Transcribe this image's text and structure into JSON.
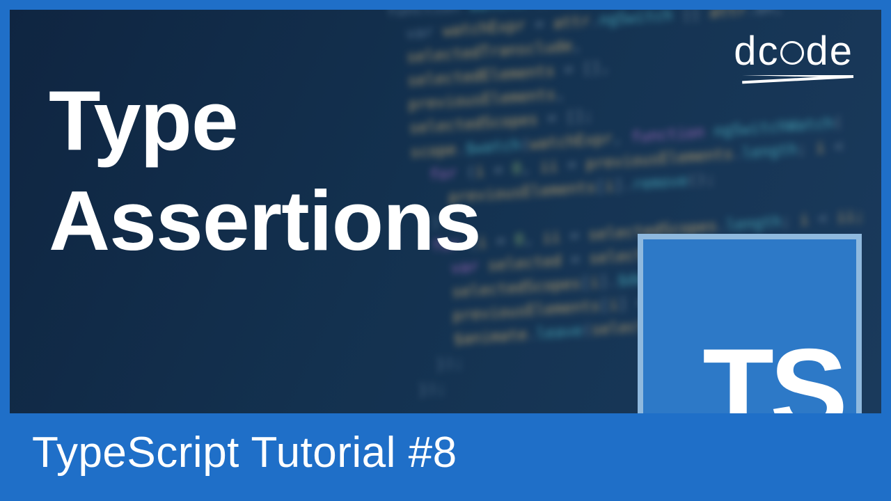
{
  "title_line1": "Type",
  "title_line2": "Assertions",
  "footer": "TypeScript Tutorial #8",
  "logo_text_left": "dc",
  "logo_text_right": "de",
  "ts_label": "TS",
  "code_lines": [
    {
      "segments": [
        {
          "c": "pl",
          "t": "function "
        },
        {
          "c": "fn",
          "t": "watcher"
        },
        {
          "c": "pn",
          "t": "(scope, "
        },
        {
          "c": "id",
          "t": "element"
        },
        {
          "c": "pn",
          "t": ", "
        },
        {
          "c": "id",
          "t": "attr"
        },
        {
          "c": "pn",
          "t": ", "
        },
        {
          "c": "fn",
          "t": "ngSwitch"
        },
        {
          "c": "pn",
          "t": ")"
        }
      ]
    },
    {
      "segments": [
        {
          "c": "pl",
          "t": "  var "
        },
        {
          "c": "id",
          "t": "watchExpr"
        },
        {
          "c": "op",
          "t": " = "
        },
        {
          "c": "id",
          "t": "attr"
        },
        {
          "c": "pn",
          "t": "."
        },
        {
          "c": "fn",
          "t": "ngSwitch"
        },
        {
          "c": "op",
          "t": " || "
        },
        {
          "c": "id",
          "t": "attr"
        },
        {
          "c": "pn",
          "t": ".on,"
        }
      ]
    },
    {
      "segments": [
        {
          "c": "pl",
          "t": "  "
        },
        {
          "c": "id",
          "t": "selectedTransclude"
        },
        {
          "c": "pn",
          "t": ","
        }
      ]
    },
    {
      "segments": [
        {
          "c": "pl",
          "t": "  "
        },
        {
          "c": "id",
          "t": "selectedElements"
        },
        {
          "c": "op",
          "t": " = "
        },
        {
          "c": "pn",
          "t": "[],"
        }
      ]
    },
    {
      "segments": [
        {
          "c": "pl",
          "t": "  "
        },
        {
          "c": "id",
          "t": "previousElements"
        },
        {
          "c": "pn",
          "t": ","
        }
      ]
    },
    {
      "segments": [
        {
          "c": "pl",
          "t": "  "
        },
        {
          "c": "id",
          "t": "selectedScopes"
        },
        {
          "c": "op",
          "t": " = "
        },
        {
          "c": "pn",
          "t": "[];"
        }
      ]
    },
    {
      "segments": [
        {
          "c": "pl",
          "t": ""
        }
      ]
    },
    {
      "segments": [
        {
          "c": "pl",
          "t": "  "
        },
        {
          "c": "id",
          "t": "scope"
        },
        {
          "c": "pn",
          "t": "."
        },
        {
          "c": "fn",
          "t": "$watch"
        },
        {
          "c": "pn",
          "t": "("
        },
        {
          "c": "id",
          "t": "watchExpr"
        },
        {
          "c": "pn",
          "t": ", "
        },
        {
          "c": "kw",
          "t": "function"
        },
        {
          "c": "pn",
          "t": " "
        },
        {
          "c": "fn",
          "t": "ngSwitchWatch"
        },
        {
          "c": "pn",
          "t": "("
        }
      ]
    },
    {
      "segments": [
        {
          "c": "pl",
          "t": "    "
        },
        {
          "c": "kw",
          "t": "for"
        },
        {
          "c": "pn",
          "t": " ("
        },
        {
          "c": "id",
          "t": "i"
        },
        {
          "c": "op",
          "t": " = "
        },
        {
          "c": "st",
          "t": "0"
        },
        {
          "c": "pn",
          "t": ", "
        },
        {
          "c": "id",
          "t": "ii"
        },
        {
          "c": "op",
          "t": " = "
        },
        {
          "c": "id",
          "t": "previousElements"
        },
        {
          "c": "pn",
          "t": "."
        },
        {
          "c": "fn",
          "t": "length"
        },
        {
          "c": "pn",
          "t": "; "
        },
        {
          "c": "id",
          "t": "i"
        },
        {
          "c": "op",
          "t": " < "
        }
      ]
    },
    {
      "segments": [
        {
          "c": "pl",
          "t": "      "
        },
        {
          "c": "id",
          "t": "previousElements"
        },
        {
          "c": "pn",
          "t": "["
        },
        {
          "c": "id",
          "t": "i"
        },
        {
          "c": "pn",
          "t": "]."
        },
        {
          "c": "fn",
          "t": "remove"
        },
        {
          "c": "pn",
          "t": "();"
        }
      ]
    },
    {
      "segments": [
        {
          "c": "pl",
          "t": "    }"
        }
      ]
    },
    {
      "segments": [
        {
          "c": "pl",
          "t": ""
        }
      ]
    },
    {
      "segments": [
        {
          "c": "pl",
          "t": "    "
        },
        {
          "c": "kw",
          "t": "for"
        },
        {
          "c": "pn",
          "t": " ("
        },
        {
          "c": "id",
          "t": "i"
        },
        {
          "c": "op",
          "t": " = "
        },
        {
          "c": "st",
          "t": "0"
        },
        {
          "c": "pn",
          "t": ", "
        },
        {
          "c": "id",
          "t": "ii"
        },
        {
          "c": "op",
          "t": " = "
        },
        {
          "c": "id",
          "t": "selectedScopes"
        },
        {
          "c": "pn",
          "t": "."
        },
        {
          "c": "fn",
          "t": "length"
        },
        {
          "c": "pn",
          "t": "; "
        },
        {
          "c": "id",
          "t": "i"
        },
        {
          "c": "op",
          "t": " < "
        },
        {
          "c": "id",
          "t": "ii;"
        }
      ]
    },
    {
      "segments": [
        {
          "c": "pl",
          "t": "      "
        },
        {
          "c": "kw",
          "t": "var"
        },
        {
          "c": "pn",
          "t": " "
        },
        {
          "c": "id",
          "t": "selected"
        },
        {
          "c": "op",
          "t": " = "
        },
        {
          "c": "id",
          "t": "selectedElements"
        },
        {
          "c": "pn",
          "t": "["
        },
        {
          "c": "id",
          "t": "i"
        },
        {
          "c": "pn",
          "t": "];"
        }
      ]
    },
    {
      "segments": [
        {
          "c": "pl",
          "t": "      "
        },
        {
          "c": "id",
          "t": "selectedScopes"
        },
        {
          "c": "pn",
          "t": "["
        },
        {
          "c": "id",
          "t": "i"
        },
        {
          "c": "pn",
          "t": "]."
        },
        {
          "c": "fn",
          "t": "$destroy"
        },
        {
          "c": "pn",
          "t": "();"
        }
      ]
    },
    {
      "segments": [
        {
          "c": "pl",
          "t": "      "
        },
        {
          "c": "id",
          "t": "previousElements"
        },
        {
          "c": "pn",
          "t": "["
        },
        {
          "c": "id",
          "t": "i"
        },
        {
          "c": "pn",
          "t": "] = "
        },
        {
          "c": "id",
          "t": "selected"
        },
        {
          "c": "pn",
          "t": ";"
        }
      ]
    },
    {
      "segments": [
        {
          "c": "pl",
          "t": "      "
        },
        {
          "c": "id",
          "t": "$animate"
        },
        {
          "c": "pn",
          "t": "."
        },
        {
          "c": "fn",
          "t": "leave"
        },
        {
          "c": "pn",
          "t": "("
        },
        {
          "c": "id",
          "t": "selected"
        },
        {
          "c": "pn",
          "t": ");"
        }
      ]
    },
    {
      "segments": [
        {
          "c": "pl",
          "t": "    });"
        }
      ]
    },
    {
      "segments": [
        {
          "c": "pl",
          "t": "  });"
        }
      ]
    }
  ]
}
